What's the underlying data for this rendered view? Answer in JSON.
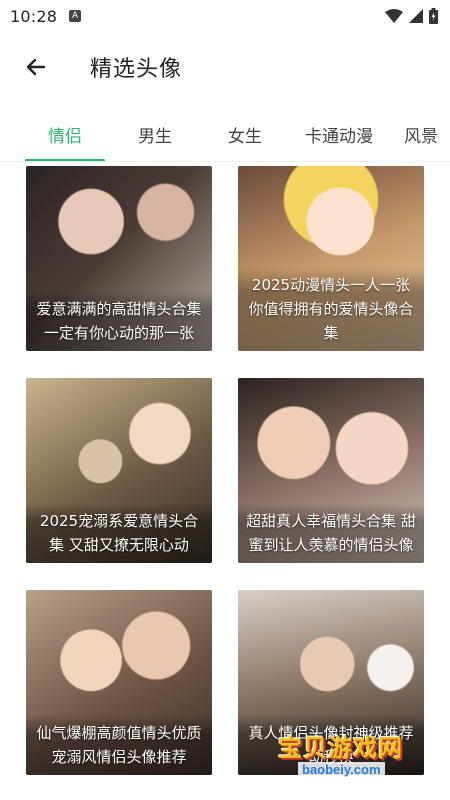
{
  "status_bar": {
    "time": "10:28",
    "notification_icon": "A",
    "icons": [
      "wifi-icon",
      "signal-icon",
      "battery-icon"
    ]
  },
  "app_bar": {
    "back_icon": "arrow-left-icon",
    "title": "精选头像"
  },
  "tabs": [
    {
      "label": "情侣",
      "active": true
    },
    {
      "label": "男生",
      "active": false
    },
    {
      "label": "女生",
      "active": false
    },
    {
      "label": "卡通动漫",
      "active": false
    },
    {
      "label": "风景",
      "active": false
    }
  ],
  "colors": {
    "accent": "#2cb56a",
    "text": "#222222",
    "tab_text": "#444444"
  },
  "cards": [
    {
      "caption": "爱意满满的高甜情头合集 一定有你心动的那一张"
    },
    {
      "caption": "2025动漫情头一人一张 你值得拥有的爱情头像合集"
    },
    {
      "caption": "2025宠溺系爱意情头合集 又甜又撩无限心动"
    },
    {
      "caption": "超甜真人幸福情头合集 甜蜜到让人羡慕的情侣头像"
    },
    {
      "caption": "仙气爆棚高颜值情头优质宠溺风情侣头像推荐"
    },
    {
      "caption": "真人情侣头像封神级推荐 动秒换"
    }
  ],
  "watermark": {
    "main": "宝贝游戏网",
    "sub": "baobeiy.com"
  }
}
